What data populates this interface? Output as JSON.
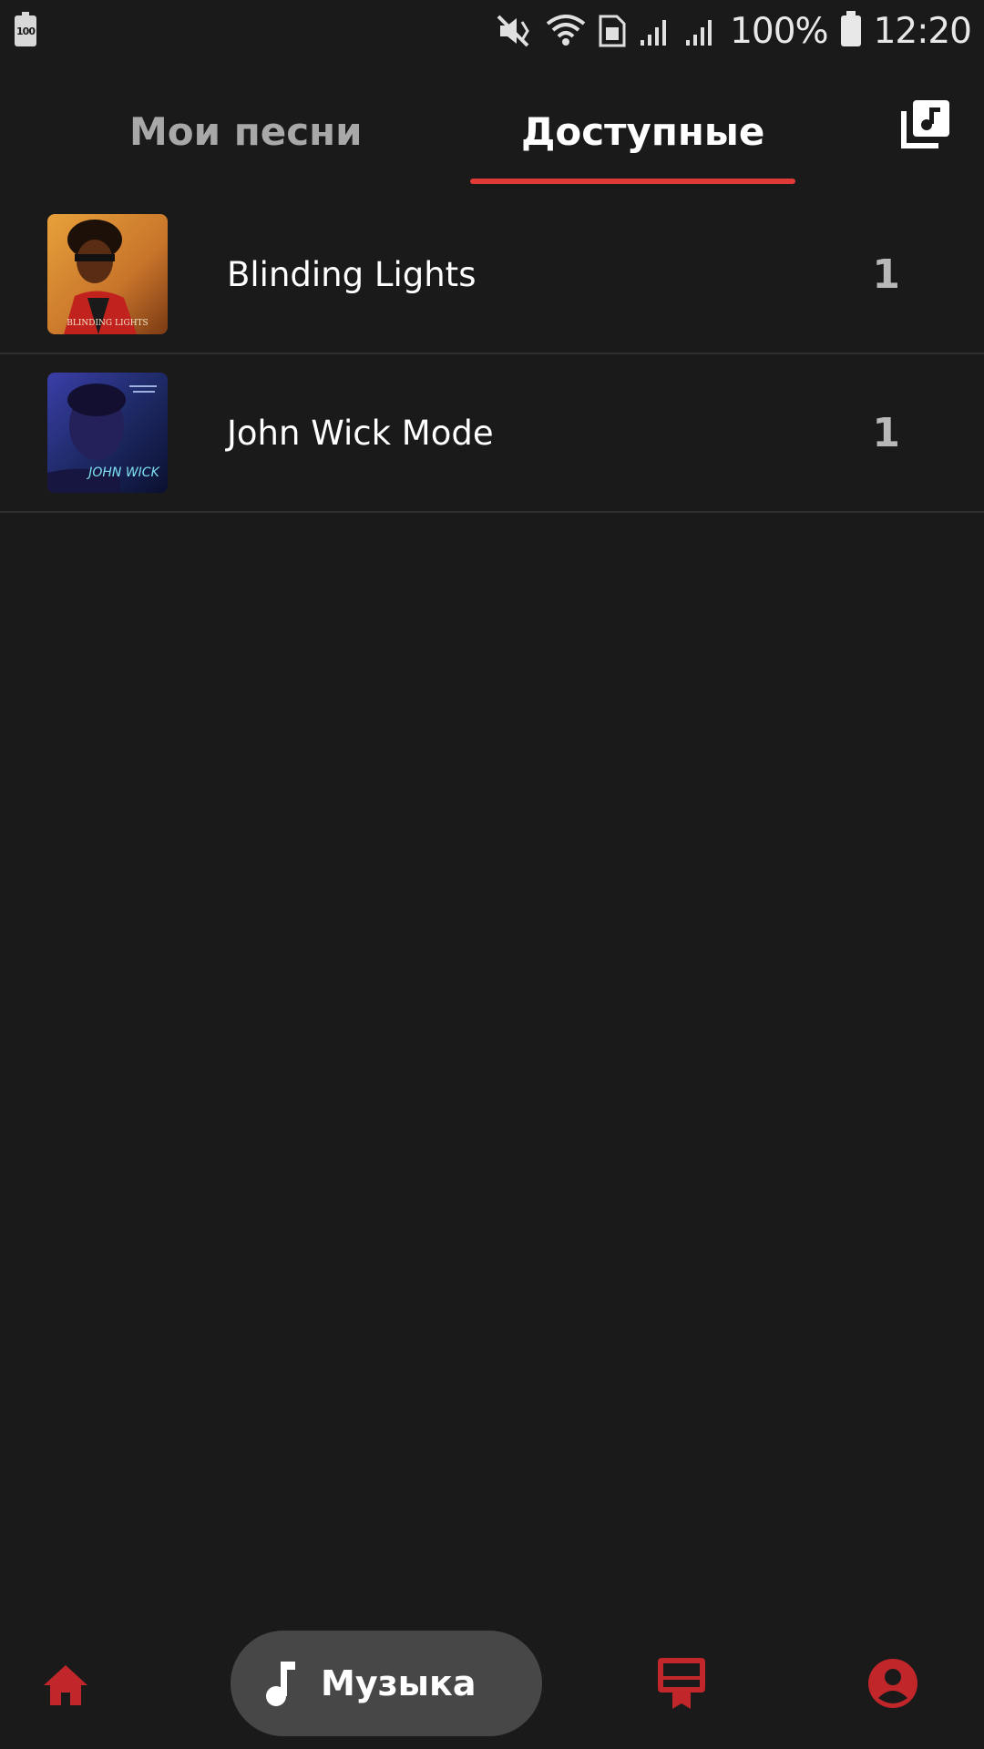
{
  "status_bar": {
    "battery_saver_label": "100",
    "battery_percent": "100%",
    "time": "12:20",
    "icons": [
      "battery-saver-icon",
      "mute-icon",
      "wifi-icon",
      "sim-icon",
      "signal-icon",
      "signal-icon",
      "battery-icon"
    ]
  },
  "tabs": {
    "my_songs": "Мои песни",
    "available": "Доступные",
    "active_tab": "available",
    "library_icon": "music-library-icon"
  },
  "songs": [
    {
      "title": "Blinding Lights",
      "count": "1",
      "cover_text": "BLINDING LIGHTS"
    },
    {
      "title": "John Wick Mode",
      "count": "1",
      "cover_text": "JOHN WICK"
    }
  ],
  "bottom_nav": {
    "home_icon": "home-icon",
    "music_label": "Музыка",
    "music_icon": "music-note-icon",
    "board_icon": "board-icon",
    "profile_icon": "profile-icon"
  },
  "colors": {
    "background": "#1a1a1a",
    "accent": "#e03a36",
    "nav_icon_red": "#c0262a",
    "pill_bg": "#474747"
  }
}
